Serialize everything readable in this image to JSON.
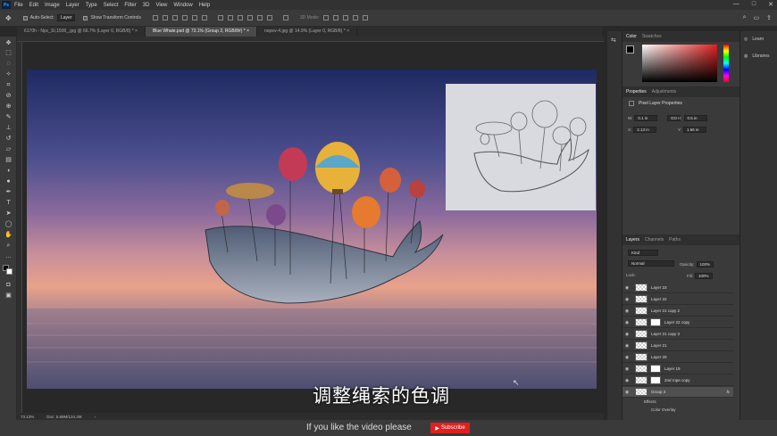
{
  "menu": {
    "logo": "Ps",
    "items": [
      "File",
      "Edit",
      "Image",
      "Layer",
      "Type",
      "Select",
      "Filter",
      "3D",
      "View",
      "Window",
      "Help"
    ],
    "window_controls": [
      "—",
      "□",
      "✕"
    ]
  },
  "options": {
    "auto_select": "Auto-Select:",
    "auto_select_value": "Layer",
    "transform_controls": "Show Transform Controls",
    "mode_3d": "3D Mode:"
  },
  "tabs": [
    {
      "label": "6170h - Npc_SI,1500_.jpg @ 66.7% (Layer 0, RGB/8) *  ×"
    },
    {
      "label": "Blue Whale.psd @ 73.1% (Group 2, RGB/8#) *  ×"
    },
    {
      "label": "nopev-4.jpg @ 14.9% (Layer 0, RGB/8) *  ×"
    }
  ],
  "subtitle": "调整绳索的色调",
  "status": {
    "zoom": "73.13%",
    "doc": "Doc: 5.69M/134.2M",
    "arrow": "›"
  },
  "footer": {
    "text": "If you like the video please",
    "subscribe": "Subscribe"
  },
  "color_panel": {
    "tab1": "Color",
    "tab2": "Swatches"
  },
  "properties_panel": {
    "tab1": "Properties",
    "tab2": "Adjustments",
    "title": "Pixel Layer Properties",
    "w_label": "W:",
    "w_value": "0.1 in",
    "h_label": "H:",
    "h_value": "0.5 in",
    "x_label": "X:",
    "x_value": "2.13 in",
    "y_label": "Y:",
    "y_value": "1.66 in",
    "link": "GO"
  },
  "layers_panel": {
    "tab1": "Layers",
    "tab2": "Channels",
    "tab3": "Paths",
    "kind": "Kind",
    "blend": "Normal",
    "opacity_label": "Opacity:",
    "opacity": "100%",
    "lock_label": "Lock:",
    "fill_label": "Fill:",
    "fill": "100%",
    "layers": [
      {
        "name": "Layer 23",
        "mask": false,
        "selected": false
      },
      {
        "name": "Layer 22",
        "mask": false,
        "selected": false
      },
      {
        "name": "Layer 21 copy 2",
        "mask": false,
        "selected": false
      },
      {
        "name": "Layer 22 copy",
        "mask": true,
        "selected": false
      },
      {
        "name": "Layer 21 copy 3",
        "mask": false,
        "selected": false
      },
      {
        "name": "Layer 21",
        "mask": false,
        "selected": false
      },
      {
        "name": "Layer 20",
        "mask": false,
        "selected": false
      },
      {
        "name": "Layer 19",
        "mask": true,
        "selected": false
      },
      {
        "name": "2nd rope copy",
        "mask": true,
        "selected": false
      },
      {
        "name": "Group 2",
        "mask": false,
        "selected": true
      }
    ],
    "effects": "Effects",
    "color_overlay": "Color Overlay",
    "fx": "fx"
  },
  "learn": {
    "learn": "Learn",
    "libraries": "Libraries"
  },
  "colors": {
    "accent": "#31a8ff",
    "subscribe": "#e02020"
  }
}
